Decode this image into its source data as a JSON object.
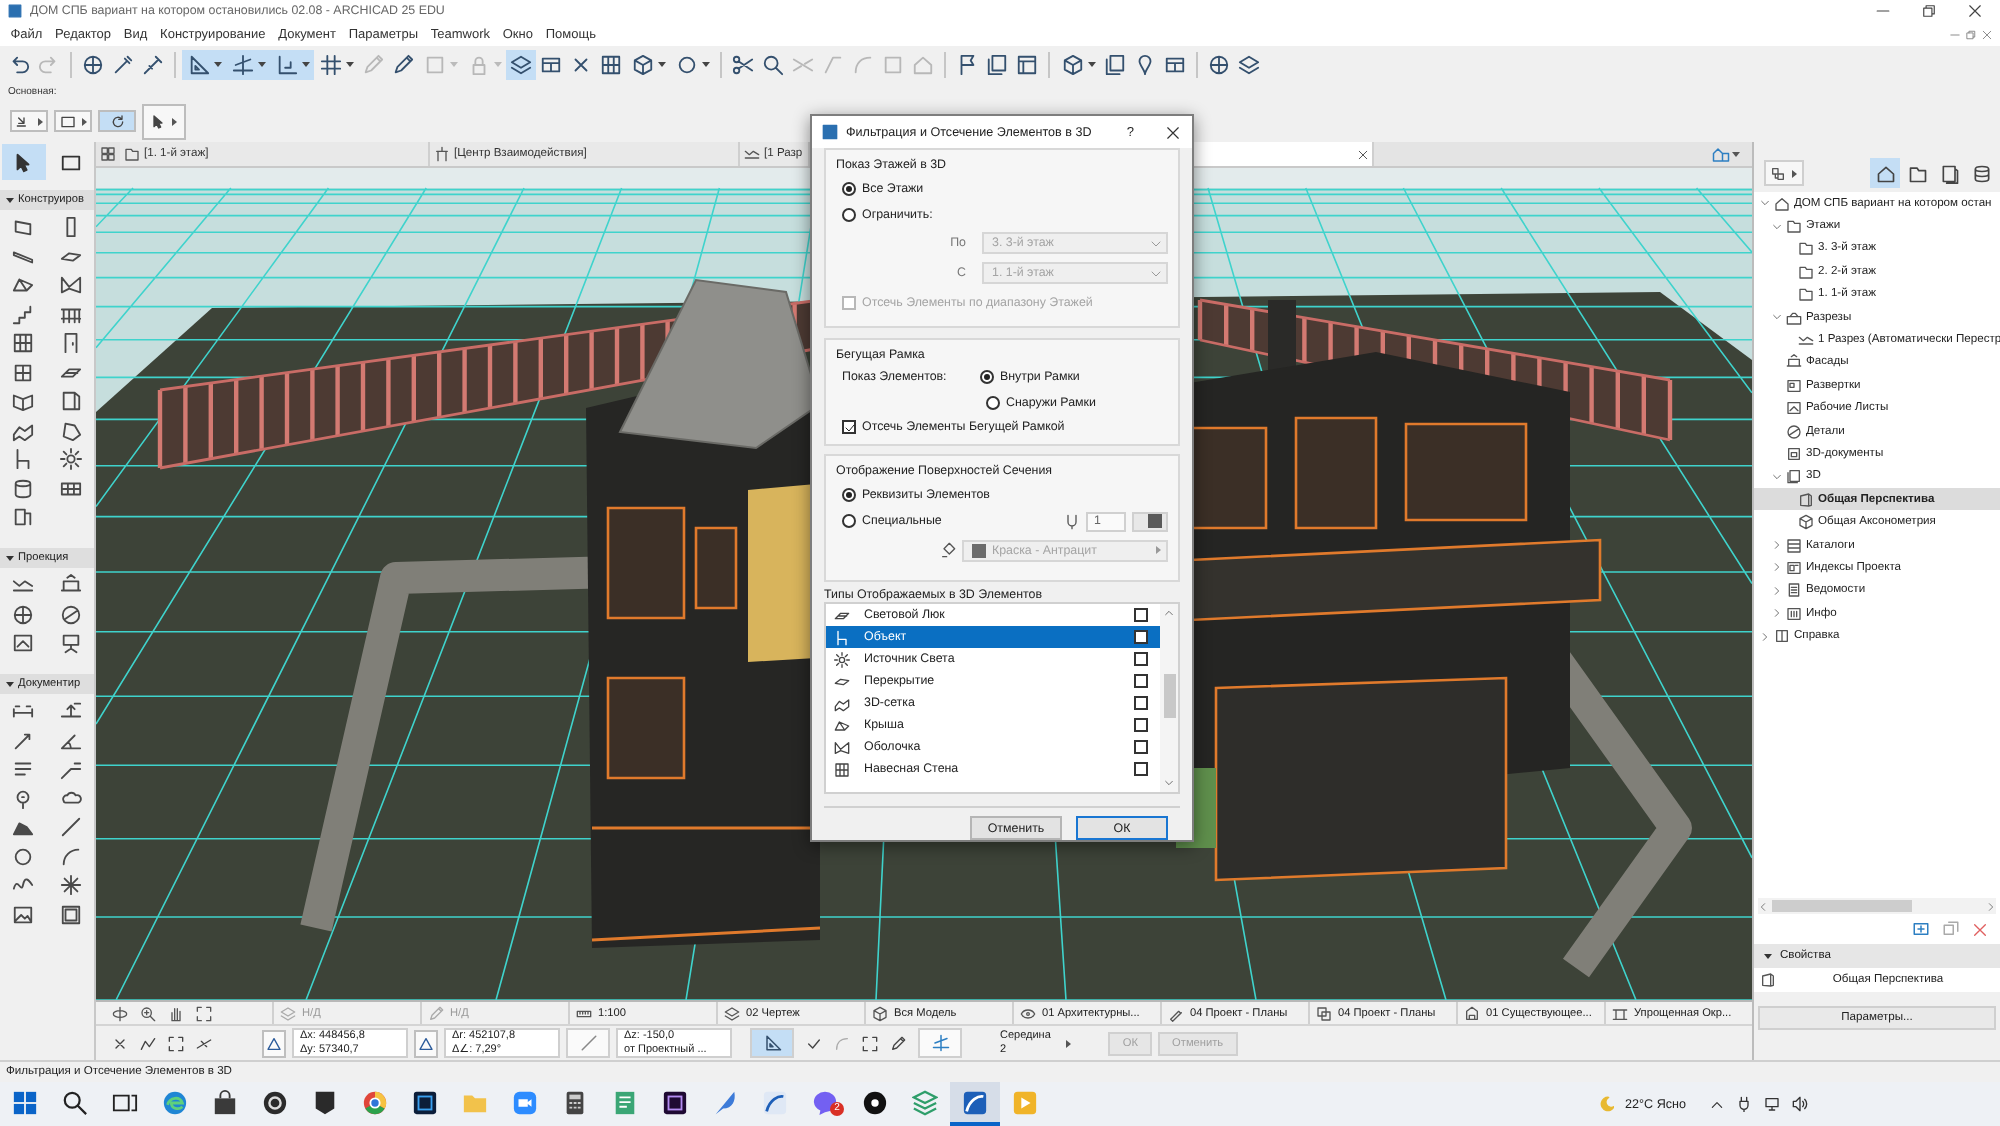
{
  "window": {
    "title": "ДОМ СПБ вариант на котором остановились 02.08 - ARCHICAD 25 EDU"
  },
  "menu": [
    "Файл",
    "Редактор",
    "Вид",
    "Конструирование",
    "Документ",
    "Параметры",
    "Teamwork",
    "Окно",
    "Помощь"
  ],
  "toolbar": [
    {
      "kind": "undo",
      "on": false,
      "disabled": false,
      "caret": false
    },
    {
      "kind": "redo",
      "on": false,
      "disabled": true,
      "caret": false
    },
    {
      "kind": "separator"
    },
    {
      "kind": "globe",
      "on": false,
      "disabled": false,
      "caret": false
    },
    {
      "kind": "pipette",
      "on": false,
      "disabled": false,
      "caret": false
    },
    {
      "kind": "syringe",
      "on": false,
      "disabled": false,
      "caret": false
    },
    {
      "kind": "separator"
    },
    {
      "kind": "ruler",
      "on": true,
      "disabled": false,
      "caret": true
    },
    {
      "kind": "guides",
      "on": true,
      "disabled": false,
      "caret": true
    },
    {
      "kind": "snap",
      "on": true,
      "disabled": false,
      "caret": true
    },
    {
      "kind": "grid",
      "on": false,
      "disabled": false,
      "caret": true
    },
    {
      "kind": "pen",
      "on": false,
      "disabled": true,
      "caret": false
    },
    {
      "kind": "pen",
      "on": false,
      "disabled": false,
      "caret": false
    },
    {
      "kind": "square",
      "on": false,
      "disabled": true,
      "caret": true
    },
    {
      "kind": "lock",
      "on": false,
      "disabled": true,
      "caret": true
    },
    {
      "kind": "layers",
      "on": true,
      "disabled": false,
      "caret": false
    },
    {
      "kind": "window",
      "on": false,
      "disabled": false,
      "caret": false
    },
    {
      "kind": "cross",
      "on": false,
      "disabled": false,
      "caret": false
    },
    {
      "kind": "curtain",
      "on": false,
      "disabled": false,
      "caret": false
    },
    {
      "kind": "cube",
      "on": false,
      "disabled": false,
      "caret": true
    },
    {
      "kind": "circle",
      "on": false,
      "disabled": false,
      "caret": true
    },
    {
      "kind": "separator"
    },
    {
      "kind": "scissors",
      "on": false,
      "disabled": false,
      "caret": false
    },
    {
      "kind": "search",
      "on": false,
      "disabled": false,
      "caret": false
    },
    {
      "kind": "trim",
      "on": false,
      "disabled": true,
      "caret": false
    },
    {
      "kind": "corner",
      "on": false,
      "disabled": true,
      "caret": false
    },
    {
      "kind": "curve",
      "on": false,
      "disabled": true,
      "caret": false
    },
    {
      "kind": "square",
      "on": false,
      "disabled": true,
      "caret": false
    },
    {
      "kind": "house",
      "on": false,
      "disabled": true,
      "caret": false
    },
    {
      "kind": "separator"
    },
    {
      "kind": "flag",
      "on": false,
      "disabled": false,
      "caret": false
    },
    {
      "kind": "sheets",
      "on": false,
      "disabled": false,
      "caret": false
    },
    {
      "kind": "layout",
      "on": false,
      "disabled": false,
      "caret": false
    },
    {
      "kind": "separator"
    },
    {
      "kind": "cube",
      "on": false,
      "disabled": false,
      "caret": true
    },
    {
      "kind": "sheets",
      "on": false,
      "disabled": false,
      "caret": false
    },
    {
      "kind": "pin",
      "on": false,
      "disabled": false,
      "caret": false
    },
    {
      "kind": "window",
      "on": false,
      "disabled": false,
      "caret": false
    },
    {
      "kind": "separator"
    },
    {
      "kind": "globe",
      "on": false,
      "disabled": false,
      "caret": false
    },
    {
      "kind": "layers",
      "on": false,
      "disabled": false,
      "caret": false
    }
  ],
  "palette": {
    "label": "Основная:",
    "buttons": [
      {
        "kind": "pick",
        "on": false,
        "caret": true
      },
      {
        "kind": "marquee",
        "on": false,
        "caret": true
      },
      {
        "kind": "rotate",
        "on": true,
        "caret": false
      },
      {
        "kind": "arrow",
        "on": false,
        "caret": true
      }
    ]
  },
  "toolbox": {
    "top": [
      {
        "kind": "arrow",
        "selected": true
      },
      {
        "kind": "marquee",
        "selected": false
      }
    ],
    "sections": [
      {
        "title": "Конструиров",
        "expanded": true
      },
      {
        "title": "Проекция",
        "expanded": true
      },
      {
        "title": "Документир",
        "expanded": true
      }
    ]
  },
  "tabs": [
    {
      "kind": "floor",
      "label": "[1. 1-й этаж]",
      "selected": false
    },
    {
      "kind": "hub",
      "label": "[Центр Взаимодействия]",
      "selected": false
    },
    {
      "kind": "section",
      "label": "[1 Разр",
      "selected": false
    },
    {
      "selected": true
    }
  ],
  "quick_options": [
    {
      "kind": "layers",
      "value": "Н/Д",
      "disabled": true
    },
    {
      "kind": "pen",
      "value": "Н/Д",
      "disabled": true
    },
    {
      "kind": "scale",
      "value": "1:100",
      "disabled": false
    },
    {
      "kind": "layers",
      "value": "02 Чертеж",
      "disabled": false
    },
    {
      "kind": "cube",
      "value": "Вся Модель",
      "disabled": false
    },
    {
      "kind": "eye",
      "value": "01 Архитектурны...",
      "disabled": false
    },
    {
      "kind": "pen-set",
      "value": "04 Проект - Планы",
      "disabled": false
    },
    {
      "kind": "override",
      "value": "04 Проект - Планы",
      "disabled": false
    },
    {
      "kind": "renovation",
      "value": "01 Существующее...",
      "disabled": false
    },
    {
      "kind": "structure",
      "value": "Упрощенная Окр...",
      "disabled": false
    }
  ],
  "coordinates": [
    [
      "Δx: 448456,8",
      "Δy: 57340,7"
    ],
    [
      "Δr: 452107,8",
      "Δ∠: 7,29°"
    ],
    [
      "Δz: -150,0",
      "от Проектный ..."
    ]
  ],
  "snap": [
    "Середина",
    "2"
  ],
  "edit_buttons": [
    {
      "label": "ОК",
      "disabled": true
    },
    {
      "label": "Отменить",
      "disabled": true
    }
  ],
  "navigator": {
    "maps": [
      {
        "kind": "project",
        "selected": true
      },
      {
        "kind": "views",
        "selected": false
      },
      {
        "kind": "layouts",
        "selected": false
      },
      {
        "kind": "publisher",
        "selected": false
      }
    ],
    "tree": [
      {
        "label": "ДОМ СПБ вариант на котором остан",
        "kind": "project",
        "expanded": true,
        "selected": false,
        "children": [
          {
            "label": "Этажи",
            "kind": "floors",
            "expanded": true,
            "selected": false,
            "children": [
              {
                "label": "3. 3-й этаж",
                "kind": "floor",
                "selected": false
              },
              {
                "label": "2. 2-й этаж",
                "kind": "floor",
                "selected": false
              },
              {
                "label": "1. 1-й этаж",
                "kind": "floor",
                "selected": false
              }
            ]
          },
          {
            "label": "Разрезы",
            "kind": "sections",
            "expanded": true,
            "selected": false,
            "children": [
              {
                "label": "1 Разрез (Автоматически Перестр",
                "kind": "section",
                "selected": false
              }
            ]
          },
          {
            "label": "Фасады",
            "kind": "elevations",
            "selected": false
          },
          {
            "label": "Развертки",
            "kind": "interiors",
            "selected": false
          },
          {
            "label": "Рабочие Листы",
            "kind": "worksheets",
            "selected": false
          },
          {
            "label": "Детали",
            "kind": "details",
            "selected": false
          },
          {
            "label": "3D-документы",
            "kind": "docs3d",
            "selected": false
          },
          {
            "label": "3D",
            "kind": "view3d",
            "expanded": true,
            "selected": false,
            "children": [
              {
                "label": "Общая Перспектива",
                "kind": "perspective",
                "selected": true
              },
              {
                "label": "Общая Аксонометрия",
                "kind": "axo",
                "selected": false
              }
            ]
          },
          {
            "label": "Каталоги",
            "kind": "catalogs",
            "expanded": false,
            "selected": false
          },
          {
            "label": "Индексы Проекта",
            "kind": "indexes",
            "expanded": false,
            "selected": false
          },
          {
            "label": "Ведомости",
            "kind": "schedules",
            "expanded": false,
            "selected": false
          },
          {
            "label": "Инфо",
            "kind": "info",
            "expanded": false,
            "selected": false
          }
        ]
      },
      {
        "label": "Справка",
        "kind": "help",
        "expanded": false,
        "selected": false
      }
    ],
    "properties": {
      "title": "Свойства",
      "expanded": true,
      "name": "Общая Перспектива",
      "button": "Параметры..."
    }
  },
  "status_bar": "Фильтрация и Отсечение Элементов в 3D",
  "taskbar": {
    "apps": [
      {
        "kind": "start",
        "active": false
      },
      {
        "kind": "search",
        "active": false
      },
      {
        "kind": "task-view",
        "active": false
      },
      {
        "kind": "browser",
        "active": false
      },
      {
        "kind": "store",
        "active": false
      },
      {
        "kind": "recorder",
        "active": false
      },
      {
        "kind": "launcher",
        "active": false
      },
      {
        "kind": "web",
        "active": false
      },
      {
        "kind": "photo-editor",
        "active": false
      },
      {
        "kind": "files",
        "active": false
      },
      {
        "kind": "video-call",
        "active": false
      },
      {
        "kind": "calculator",
        "active": false
      },
      {
        "kind": "notes",
        "active": false
      },
      {
        "kind": "video-editor",
        "active": false
      },
      {
        "kind": "sketch",
        "active": false
      },
      {
        "kind": "cad-viewer",
        "active": false
      },
      {
        "kind": "messenger",
        "active": false,
        "badge": "2"
      },
      {
        "kind": "terminal",
        "active": false
      },
      {
        "kind": "sheets",
        "active": false
      },
      {
        "kind": "cad",
        "active": true
      },
      {
        "kind": "player",
        "active": false
      }
    ],
    "weather": "22°C Ясно"
  },
  "dialog": {
    "title": "Фильтрация и Отсечение Элементов в 3D",
    "help": "?",
    "floors": {
      "title": "Показ Этажей в 3D",
      "options": [
        {
          "label": "Все Этажи",
          "selected": true
        },
        {
          "label": "Ограничить:",
          "selected": false
        }
      ],
      "range": [
        {
          "label": "По",
          "value": "3. 3-й этаж",
          "disabled": true
        },
        {
          "label": "С",
          "value": "1. 1-й этаж",
          "disabled": true
        }
      ],
      "clip": {
        "label": "Отсечь Элементы по диапазону Этажей",
        "checked": false,
        "disabled": true
      }
    },
    "marquee": {
      "title": "Бегущая Рамка",
      "label": "Показ Элементов:",
      "options": [
        {
          "label": "Внутри Рамки",
          "selected": true
        },
        {
          "label": "Снаружи Рамки",
          "selected": false
        }
      ],
      "clip": {
        "label": "Отсечь Элементы Бегущей Рамкой",
        "checked": true,
        "disabled": false
      }
    },
    "cut": {
      "title": "Отображение Поверхностей Сечения",
      "options": [
        {
          "label": "Реквизиты Элементов",
          "selected": true
        },
        {
          "label": "Специальные",
          "selected": false
        }
      ],
      "pen": {
        "value": "1",
        "disabled": true
      },
      "surface": {
        "value": "Краска - Антрацит",
        "disabled": true
      }
    },
    "types": {
      "title": "Типы Отображаемых в 3D Элементов",
      "items": [
        {
          "kind": "skylight",
          "label": "Световой Люк",
          "checked": false,
          "selected": false
        },
        {
          "kind": "object",
          "label": "Объект",
          "checked": false,
          "selected": true
        },
        {
          "kind": "lamp",
          "label": "Источник Света",
          "checked": false,
          "selected": false
        },
        {
          "kind": "slab",
          "label": "Перекрытие",
          "checked": false,
          "selected": false
        },
        {
          "kind": "mesh",
          "label": "3D-сетка",
          "checked": false,
          "selected": false
        },
        {
          "kind": "roof",
          "label": "Крыша",
          "checked": false,
          "selected": false
        },
        {
          "kind": "shell",
          "label": "Оболочка",
          "checked": false,
          "selected": false
        },
        {
          "kind": "curtain",
          "label": "Навесная Стена",
          "checked": false,
          "selected": false
        }
      ]
    },
    "buttons": [
      {
        "label": "Отменить",
        "default": false
      },
      {
        "label": "ОК",
        "default": true
      }
    ]
  }
}
